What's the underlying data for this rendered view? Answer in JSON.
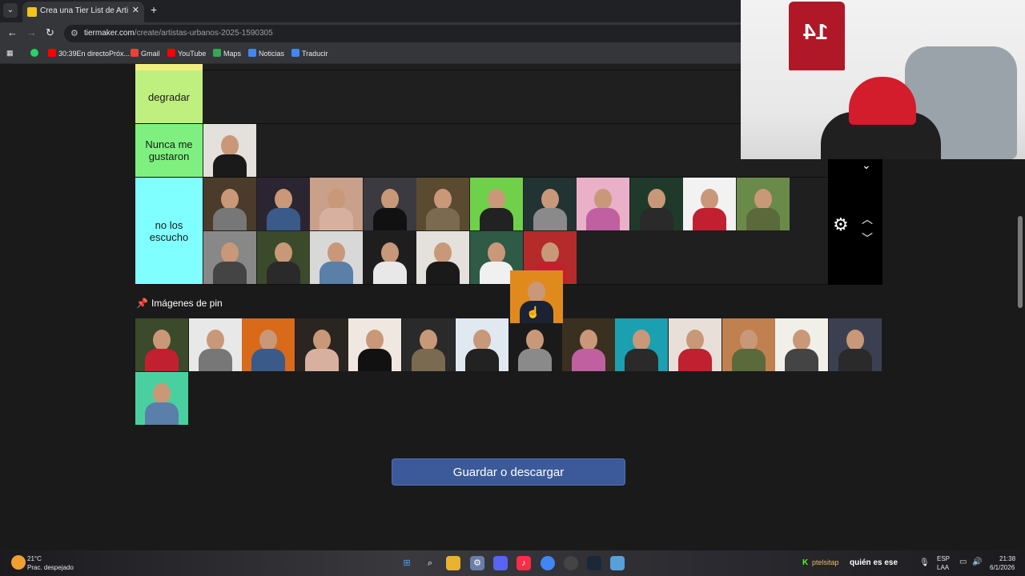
{
  "browser": {
    "tab_title": "Crea una Tier List de Artistas Ur",
    "url_host": "tiermaker.com",
    "url_path": "/create/artistas-urbanos-2025-1590305",
    "bookmarks": [
      {
        "label": "30:39En directoPróx..."
      },
      {
        "label": "Gmail"
      },
      {
        "label": "YouTube"
      },
      {
        "label": "Maps"
      },
      {
        "label": "Noticias"
      },
      {
        "label": "Traducir"
      }
    ]
  },
  "tiers": [
    {
      "label": "degradar",
      "color": "#bff07f",
      "count": 0
    },
    {
      "label": "Nunca me gustaron",
      "color": "#7ff07f",
      "count": 1
    },
    {
      "label": "no los escucho",
      "color": "#7fffff",
      "count": 18
    }
  ],
  "pin_section": {
    "title": "Imágenes de pin",
    "count": 15
  },
  "save_button": "Guardar o descargar",
  "taskbar": {
    "temperature": "21°C",
    "weather": "Prac. despejado",
    "chat_user": "ptelsitap",
    "chat_message": "quién es ese",
    "lang_top": "ESP",
    "lang_bottom": "LAA",
    "time": "21:38",
    "date": "6/1/2026"
  },
  "colors": {
    "accent": "#3c5a99",
    "page_bg": "#1a1a1a"
  }
}
